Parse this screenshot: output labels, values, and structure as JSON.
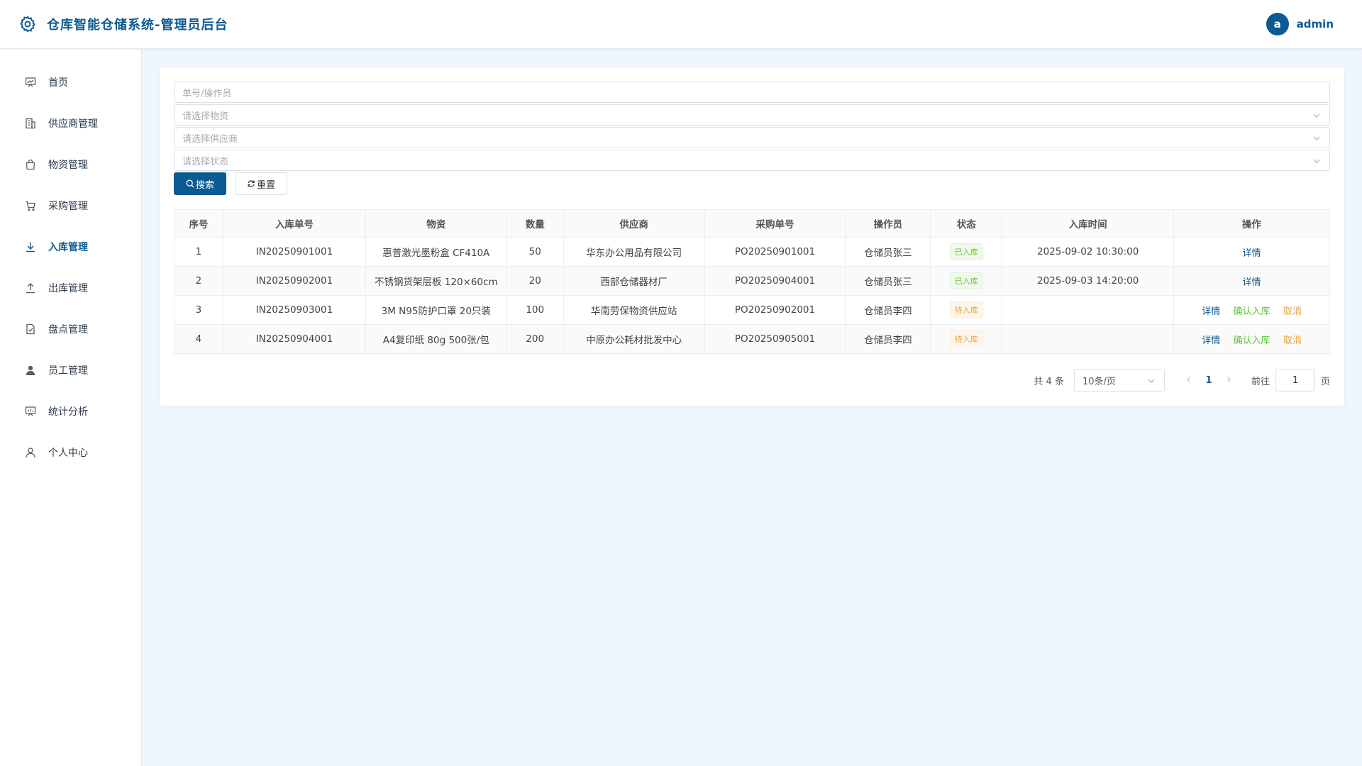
{
  "header": {
    "title": "仓库智能仓储系统-管理员后台",
    "avatar_letter": "a",
    "username": "admin"
  },
  "sidebar": {
    "items": [
      {
        "label": "首页",
        "icon": "dashboard-icon"
      },
      {
        "label": "供应商管理",
        "icon": "building-icon"
      },
      {
        "label": "物资管理",
        "icon": "bag-icon"
      },
      {
        "label": "采购管理",
        "icon": "cart-icon"
      },
      {
        "label": "入库管理",
        "icon": "download-icon",
        "active": true
      },
      {
        "label": "出库管理",
        "icon": "upload-icon"
      },
      {
        "label": "盘点管理",
        "icon": "checklist-icon"
      },
      {
        "label": "员工管理",
        "icon": "user-filled-icon"
      },
      {
        "label": "统计分析",
        "icon": "chart-board-icon"
      },
      {
        "label": "个人中心",
        "icon": "user-icon"
      }
    ]
  },
  "filters": {
    "keyword_placeholder": "单号/操作员",
    "material_placeholder": "请选择物资",
    "supplier_placeholder": "请选择供应商",
    "status_placeholder": "请选择状态",
    "search_label": "搜索",
    "reset_label": "重置"
  },
  "table": {
    "headers": [
      "序号",
      "入库单号",
      "物资",
      "数量",
      "供应商",
      "采购单号",
      "操作员",
      "状态",
      "入库时间",
      "操作"
    ],
    "rows": [
      {
        "index": "1",
        "inbound_no": "IN20250901001",
        "material": "惠普激光墨粉盒 CF410A",
        "qty": "50",
        "supplier": "华东办公用品有限公司",
        "po_no": "PO20250901001",
        "operator": "仓储员张三",
        "status": "已入库",
        "time": "2025-09-02 10:30:00"
      },
      {
        "index": "2",
        "inbound_no": "IN20250902001",
        "material": "不锈钢货架层板 120×60cm",
        "qty": "20",
        "supplier": "西部仓储器材厂",
        "po_no": "PO20250904001",
        "operator": "仓储员张三",
        "status": "已入库",
        "time": "2025-09-03 14:20:00"
      },
      {
        "index": "3",
        "inbound_no": "IN20250903001",
        "material": "3M N95防护口罩 20只装",
        "qty": "100",
        "supplier": "华南劳保物资供应站",
        "po_no": "PO20250902001",
        "operator": "仓储员李四",
        "status": "待入库",
        "time": ""
      },
      {
        "index": "4",
        "inbound_no": "IN20250904001",
        "material": "A4复印纸 80g 500张/包",
        "qty": "200",
        "supplier": "中原办公耗材批发中心",
        "po_no": "PO20250905001",
        "operator": "仓储员李四",
        "status": "待入库",
        "time": ""
      }
    ],
    "actions": {
      "detail": "详情",
      "confirm": "确认入库",
      "cancel": "取消"
    }
  },
  "pagination": {
    "total": "共 4 条",
    "page_size": "10条/页",
    "current_page": "1",
    "goto_label": "前往",
    "goto_value": "1",
    "page_suffix": "页"
  },
  "colors": {
    "primary": "#0c5a92",
    "success": "#67c23a",
    "warning": "#e6a23c",
    "background": "#f0f6fd"
  }
}
